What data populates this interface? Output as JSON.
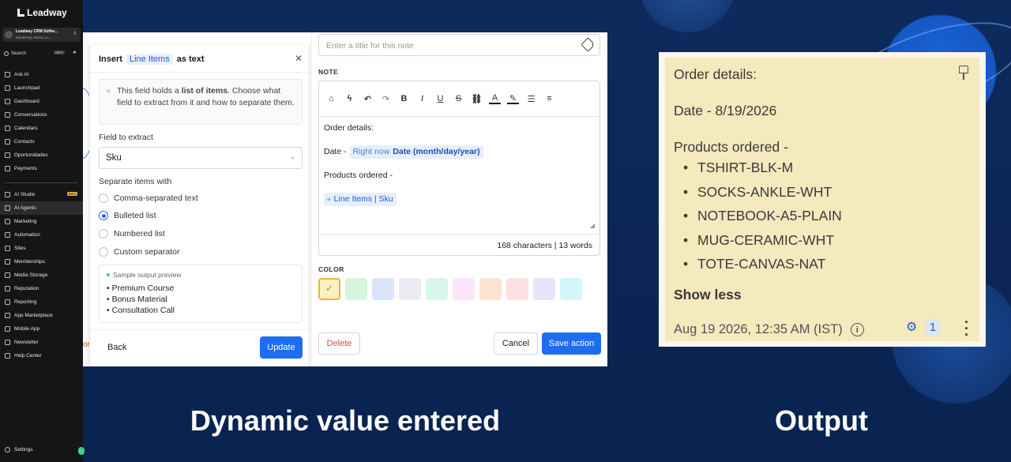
{
  "sidebar": {
    "logo": "Leadway",
    "account_name": "Leadway CRM Softw...",
    "account_location": "Monterrey, Nuevo Le...",
    "search_label": "Search",
    "search_shortcut": "ctrl K",
    "items": [
      {
        "label": "Ask AI"
      },
      {
        "label": "Launchpad"
      },
      {
        "label": "Dashboard"
      },
      {
        "label": "Conversations"
      },
      {
        "label": "Calendars"
      },
      {
        "label": "Contacts"
      },
      {
        "label": "Oportunidades"
      },
      {
        "label": "Payments"
      }
    ],
    "items2": [
      {
        "label": "AI Studio",
        "badge": "Beta"
      },
      {
        "label": "AI Agents"
      },
      {
        "label": "Marketing"
      },
      {
        "label": "Automation"
      },
      {
        "label": "Sites"
      },
      {
        "label": "Memberships"
      },
      {
        "label": "Media Storage"
      },
      {
        "label": "Reputation"
      },
      {
        "label": "Reporting"
      },
      {
        "label": "App Marketplace"
      },
      {
        "label": "Mobile App"
      },
      {
        "label": "Newsletter"
      },
      {
        "label": "Help Center"
      }
    ],
    "settings": "Settings"
  },
  "background": {
    "partial_text": "or"
  },
  "insert_modal": {
    "title_prefix": "Insert",
    "title_chip": "Line Items",
    "title_suffix": "as text",
    "info_part1": "This field holds a ",
    "info_bold": "list of items",
    "info_part2": ". Choose what field to extract from it and how to separate them.",
    "field_label": "Field to extract",
    "field_value": "Sku",
    "separate_label": "Separate items with",
    "options": [
      {
        "label": "Comma-separated text",
        "selected": false
      },
      {
        "label": "Bulleted list",
        "selected": true
      },
      {
        "label": "Numbered list",
        "selected": false
      },
      {
        "label": "Custom separator",
        "selected": false
      }
    ],
    "preview_title": "Sample output preview",
    "preview_items": [
      "Premium Course",
      "Bonus Material",
      "Consultation Call"
    ],
    "back": "Back",
    "update": "Update"
  },
  "note_panel": {
    "title_placeholder": "Enter a title for this note",
    "note_label": "NOTE",
    "line1": "Order details:",
    "date_prefix": "Date -",
    "date_chip_muted": "Right now",
    "date_chip_bold": "Date (month/day/year)",
    "products_line": "Products ordered -",
    "line_items_chip": "Line Items | Sku",
    "counter": "168 characters | 13 words",
    "color_label": "COLOR",
    "swatches": [
      "#fdf0c4",
      "#d7f5dc",
      "#dbe6fc",
      "#ecebf3",
      "#d6f7ea",
      "#fbe6fb",
      "#fde3d2",
      "#fde0e3",
      "#e6e4fb",
      "#d3f5f8"
    ],
    "delete": "Delete",
    "cancel": "Cancel",
    "save": "Save action"
  },
  "output_card": {
    "line1": "Order details:",
    "line2": "Date - 8/19/2026",
    "line3": "Products ordered -",
    "items": [
      "TSHIRT-BLK-M",
      "SOCKS-ANKLE-WHT",
      "NOTEBOOK-A5-PLAIN",
      "MUG-CERAMIC-WHT",
      "TOTE-CANVAS-NAT"
    ],
    "show_less": "Show less",
    "timestamp": "Aug 19 2026, 12:35 AM (IST)",
    "count": "1"
  },
  "captions": {
    "left": "Dynamic value entered",
    "right": "Output"
  }
}
